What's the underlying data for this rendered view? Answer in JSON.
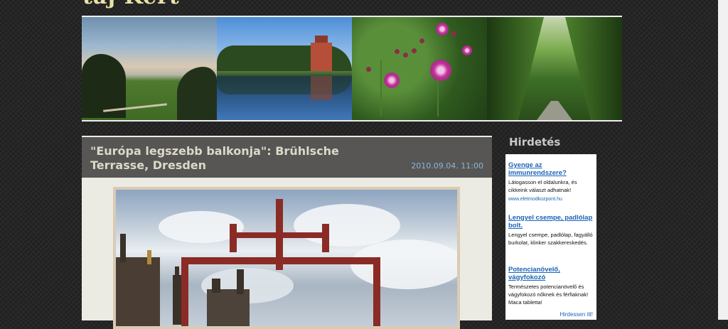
{
  "site": {
    "title_fragment": "táj Kert"
  },
  "post": {
    "title": "\"Európa legszebb balkonja\": Brühlsche Terrasse, Dresden",
    "date": "2010.09.04. 11:00"
  },
  "sidebar": {
    "heading": "Hirdetés",
    "ads": [
      {
        "title": "Gyenge az immunrendszere?",
        "text": "Látogasson el oldalunkra, és cikkeink választ adhatnak!",
        "url": "www.eletmodkozpont.hu"
      },
      {
        "title": "Lengyel csempe, padlólap bolt.",
        "text": "Lengyel csempe, padlólap, fagyálló burkolat, klinker szakkereskedés.",
        "url": ""
      },
      {
        "title": "Potencianövelő, vágyfokozó",
        "text": "Természetes potencianövelő és vágyfokozó nőknek és férfiaknak! Maca tabletta!",
        "url": ""
      }
    ],
    "advertise_link": "Hirdessen itt!"
  },
  "colors": {
    "background": "#262626",
    "post_header": "#575654",
    "post_body": "#ecebe3",
    "date_link": "#89b6de",
    "ad_link": "#1a63b8",
    "site_title": "#e8e2a6"
  },
  "icons": {
    "banner_photos": [
      "park-sky-photo",
      "lake-mansion-photo",
      "pink-flowers-photo",
      "tree-avenue-photo"
    ],
    "post_photo": "dresden-red-frame-photo"
  }
}
